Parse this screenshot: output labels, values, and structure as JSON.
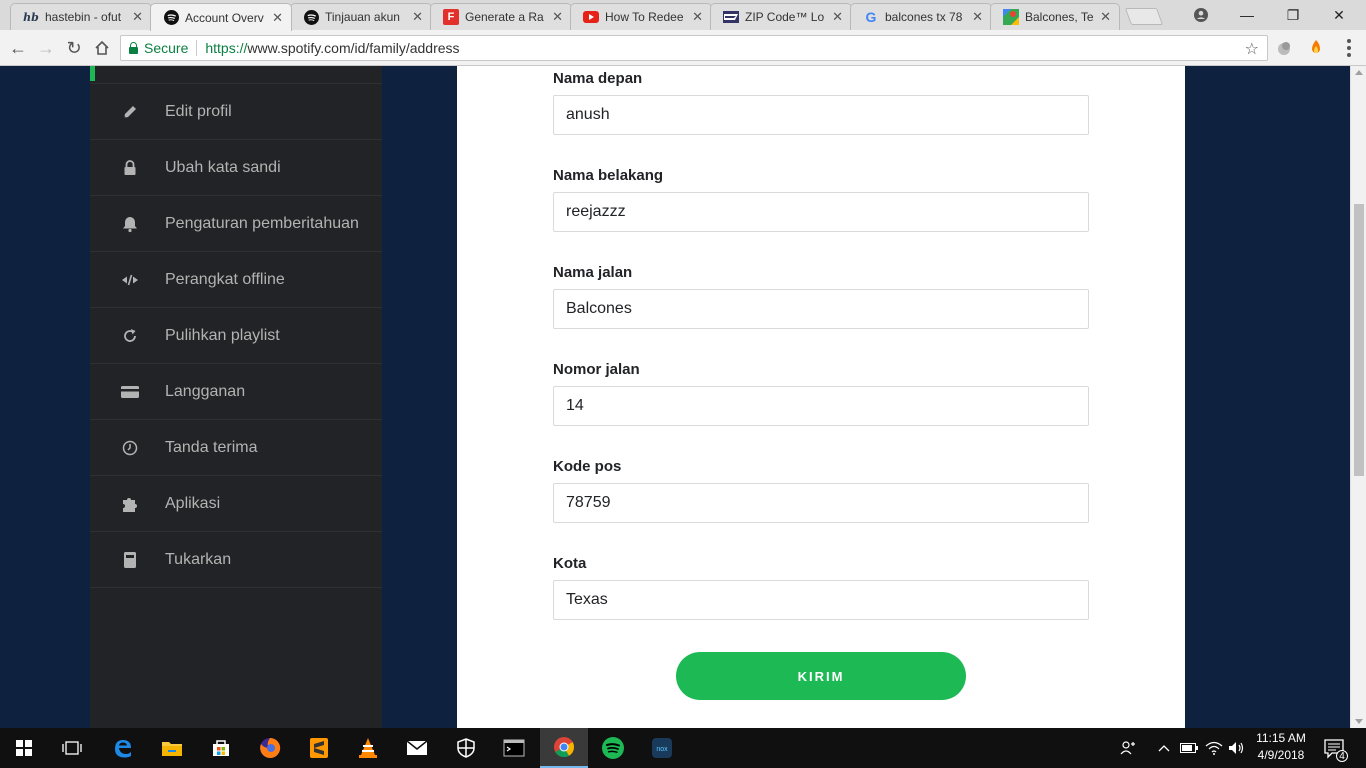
{
  "browser": {
    "tabs": [
      {
        "title": "hastebin - ofut",
        "icon": "hastebin-icon"
      },
      {
        "title": "Account Overv",
        "icon": "spotify-icon"
      },
      {
        "title": "Tinjauan akun",
        "icon": "spotify-icon"
      },
      {
        "title": "Generate a Ra",
        "icon": "f-logo-icon"
      },
      {
        "title": "How To Redee",
        "icon": "youtube-icon"
      },
      {
        "title": "ZIP Code™ Lo",
        "icon": "usps-icon"
      },
      {
        "title": "balcones tx 78",
        "icon": "google-icon"
      },
      {
        "title": "Balcones, Texa",
        "icon": "google-maps-icon"
      }
    ],
    "address": {
      "secure_label": "Secure",
      "url_protocol": "https://",
      "url_rest": "www.spotify.com/id/family/address"
    }
  },
  "sidebar": {
    "items": [
      {
        "label": "Edit profil",
        "icon": "pencil-icon"
      },
      {
        "label": "Ubah kata sandi",
        "icon": "lock-icon"
      },
      {
        "label": "Pengaturan pemberitahuan",
        "icon": "bell-icon"
      },
      {
        "label": "Perangkat offline",
        "icon": "offline-devices-icon"
      },
      {
        "label": "Pulihkan playlist",
        "icon": "refresh-icon"
      },
      {
        "label": "Langganan",
        "icon": "credit-card-icon"
      },
      {
        "label": "Tanda terima",
        "icon": "clock-icon"
      },
      {
        "label": "Aplikasi",
        "icon": "puzzle-icon"
      },
      {
        "label": "Tukarkan",
        "icon": "gift-card-icon"
      }
    ]
  },
  "form": {
    "fields": [
      {
        "label": "Nama depan",
        "value": "anush"
      },
      {
        "label": "Nama belakang",
        "value": "reejazzz"
      },
      {
        "label": "Nama jalan",
        "value": "Balcones"
      },
      {
        "label": "Nomor jalan",
        "value": "14"
      },
      {
        "label": "Kode pos",
        "value": "78759"
      },
      {
        "label": "Kota",
        "value": "Texas"
      }
    ],
    "submit_label": "KIRIM"
  },
  "taskbar": {
    "time": "11:15 AM",
    "date": "4/9/2018",
    "notification_count": "4"
  },
  "colors": {
    "accent": "#1db954",
    "page_background": "#0e2240",
    "sidebar": "#222326"
  }
}
